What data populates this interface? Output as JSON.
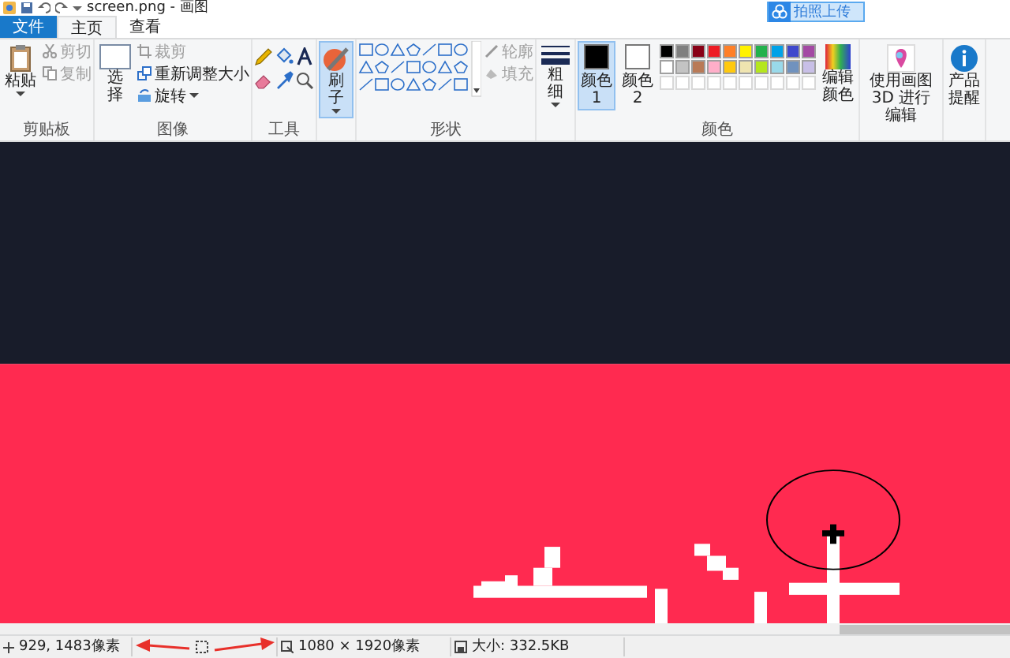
{
  "window": {
    "title": "screen.png - 画图"
  },
  "upload_button": {
    "label": "拍照上传"
  },
  "tabs": [
    {
      "label": "文件",
      "kind": "file",
      "selected": false
    },
    {
      "label": "主页",
      "kind": "tab",
      "selected": true
    },
    {
      "label": "查看",
      "kind": "tab",
      "selected": false
    }
  ],
  "clipboard": {
    "label": "剪贴板",
    "paste": "粘贴",
    "cut": {
      "label": "剪切",
      "disabled": true
    },
    "copy": {
      "label": "复制",
      "disabled": true
    }
  },
  "image": {
    "label": "图像",
    "select": "选择",
    "crop": {
      "label": "裁剪",
      "disabled": true
    },
    "resize": {
      "label": "重新调整大小",
      "disabled": false
    },
    "rotate": {
      "label": "旋转",
      "disabled": false
    }
  },
  "tools": {
    "label": "工具"
  },
  "brush": {
    "label": "刷子",
    "selected": true
  },
  "shapes": {
    "label": "形状",
    "outline": {
      "label": "轮廓",
      "disabled": true
    },
    "fill": {
      "label": "填充",
      "disabled": true
    }
  },
  "thickness": {
    "label": "粗细"
  },
  "colors": {
    "label": "颜色",
    "slots": [
      {
        "label": "颜色 1",
        "color": "#000000",
        "selected": true
      },
      {
        "label": "颜色 2",
        "color": "#ffffff",
        "selected": false
      }
    ],
    "palette": [
      {
        "color": "#000000"
      },
      {
        "color": "#7f7f7f"
      },
      {
        "color": "#880015"
      },
      {
        "color": "#ed1c24"
      },
      {
        "color": "#ff7f27"
      },
      {
        "color": "#fff200"
      },
      {
        "color": "#22b14c"
      },
      {
        "color": "#00a2e8"
      },
      {
        "color": "#3f48cc"
      },
      {
        "color": "#a349a4"
      },
      {
        "color": "#ffffff"
      },
      {
        "color": "#c3c3c3"
      },
      {
        "color": "#b97a57"
      },
      {
        "color": "#ffaec9"
      },
      {
        "color": "#ffc90e"
      },
      {
        "color": "#efe4b0"
      },
      {
        "color": "#b5e61d"
      },
      {
        "color": "#99d9ea"
      },
      {
        "color": "#7092be"
      },
      {
        "color": "#c8bfe7"
      }
    ],
    "edit_colors": "编辑颜色"
  },
  "paint3d": {
    "label": "使用画图 3D 进行编辑"
  },
  "product_alert": {
    "label": "产品提醒"
  },
  "status_bar": {
    "cursor_position": "929, 1483像素",
    "canvas_size": "1080 × 1920像素",
    "file_size": "大小: 332.5KB"
  }
}
